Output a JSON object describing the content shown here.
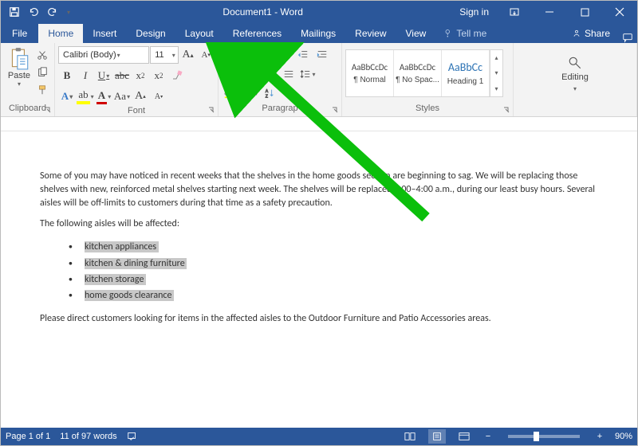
{
  "titlebar": {
    "title": "Document1 - Word",
    "signin": "Sign in"
  },
  "tabs": {
    "file": "File",
    "home": "Home",
    "insert": "Insert",
    "design": "Design",
    "layout": "Layout",
    "references": "References",
    "mailings": "Mailings",
    "review": "Review",
    "view": "View",
    "tellme": "Tell me",
    "share": "Share"
  },
  "ribbon": {
    "clipboard_label": "Clipboard",
    "paste_label": "Paste",
    "font_label": "Font",
    "font_name": "Calibri (Body)",
    "font_size": "11",
    "paragraph_label": "Paragrap",
    "styles_label": "Styles",
    "style_preview": "AaBbCcDc",
    "style_preview_h": "AaBbCc",
    "style1": "¶ Normal",
    "style2": "¶ No Spac...",
    "style3": "Heading 1",
    "editing_label": "Editing"
  },
  "document": {
    "p1": "Some of you may have noticed in recent weeks that the shelves in the home goods section are beginning to sag. We will be replacing those shelves with new, reinforced metal shelves starting next week. The shelves will be replaced 1:00–4:00 a.m., during our least busy hours. Several aisles will be off-limits to customers during that time as a safety precaution.",
    "p2": "The following aisles will be affected:",
    "b1": "kitchen appliances",
    "b2": "kitchen & dining furniture",
    "b3": "kitchen storage",
    "b4": "home goods clearance",
    "p3": "Please direct customers looking for items in the affected aisles to the Outdoor Furniture and Patio Accessories areas."
  },
  "status": {
    "page": "Page 1 of 1",
    "words": "11 of 97 words",
    "zoom": "90%"
  }
}
